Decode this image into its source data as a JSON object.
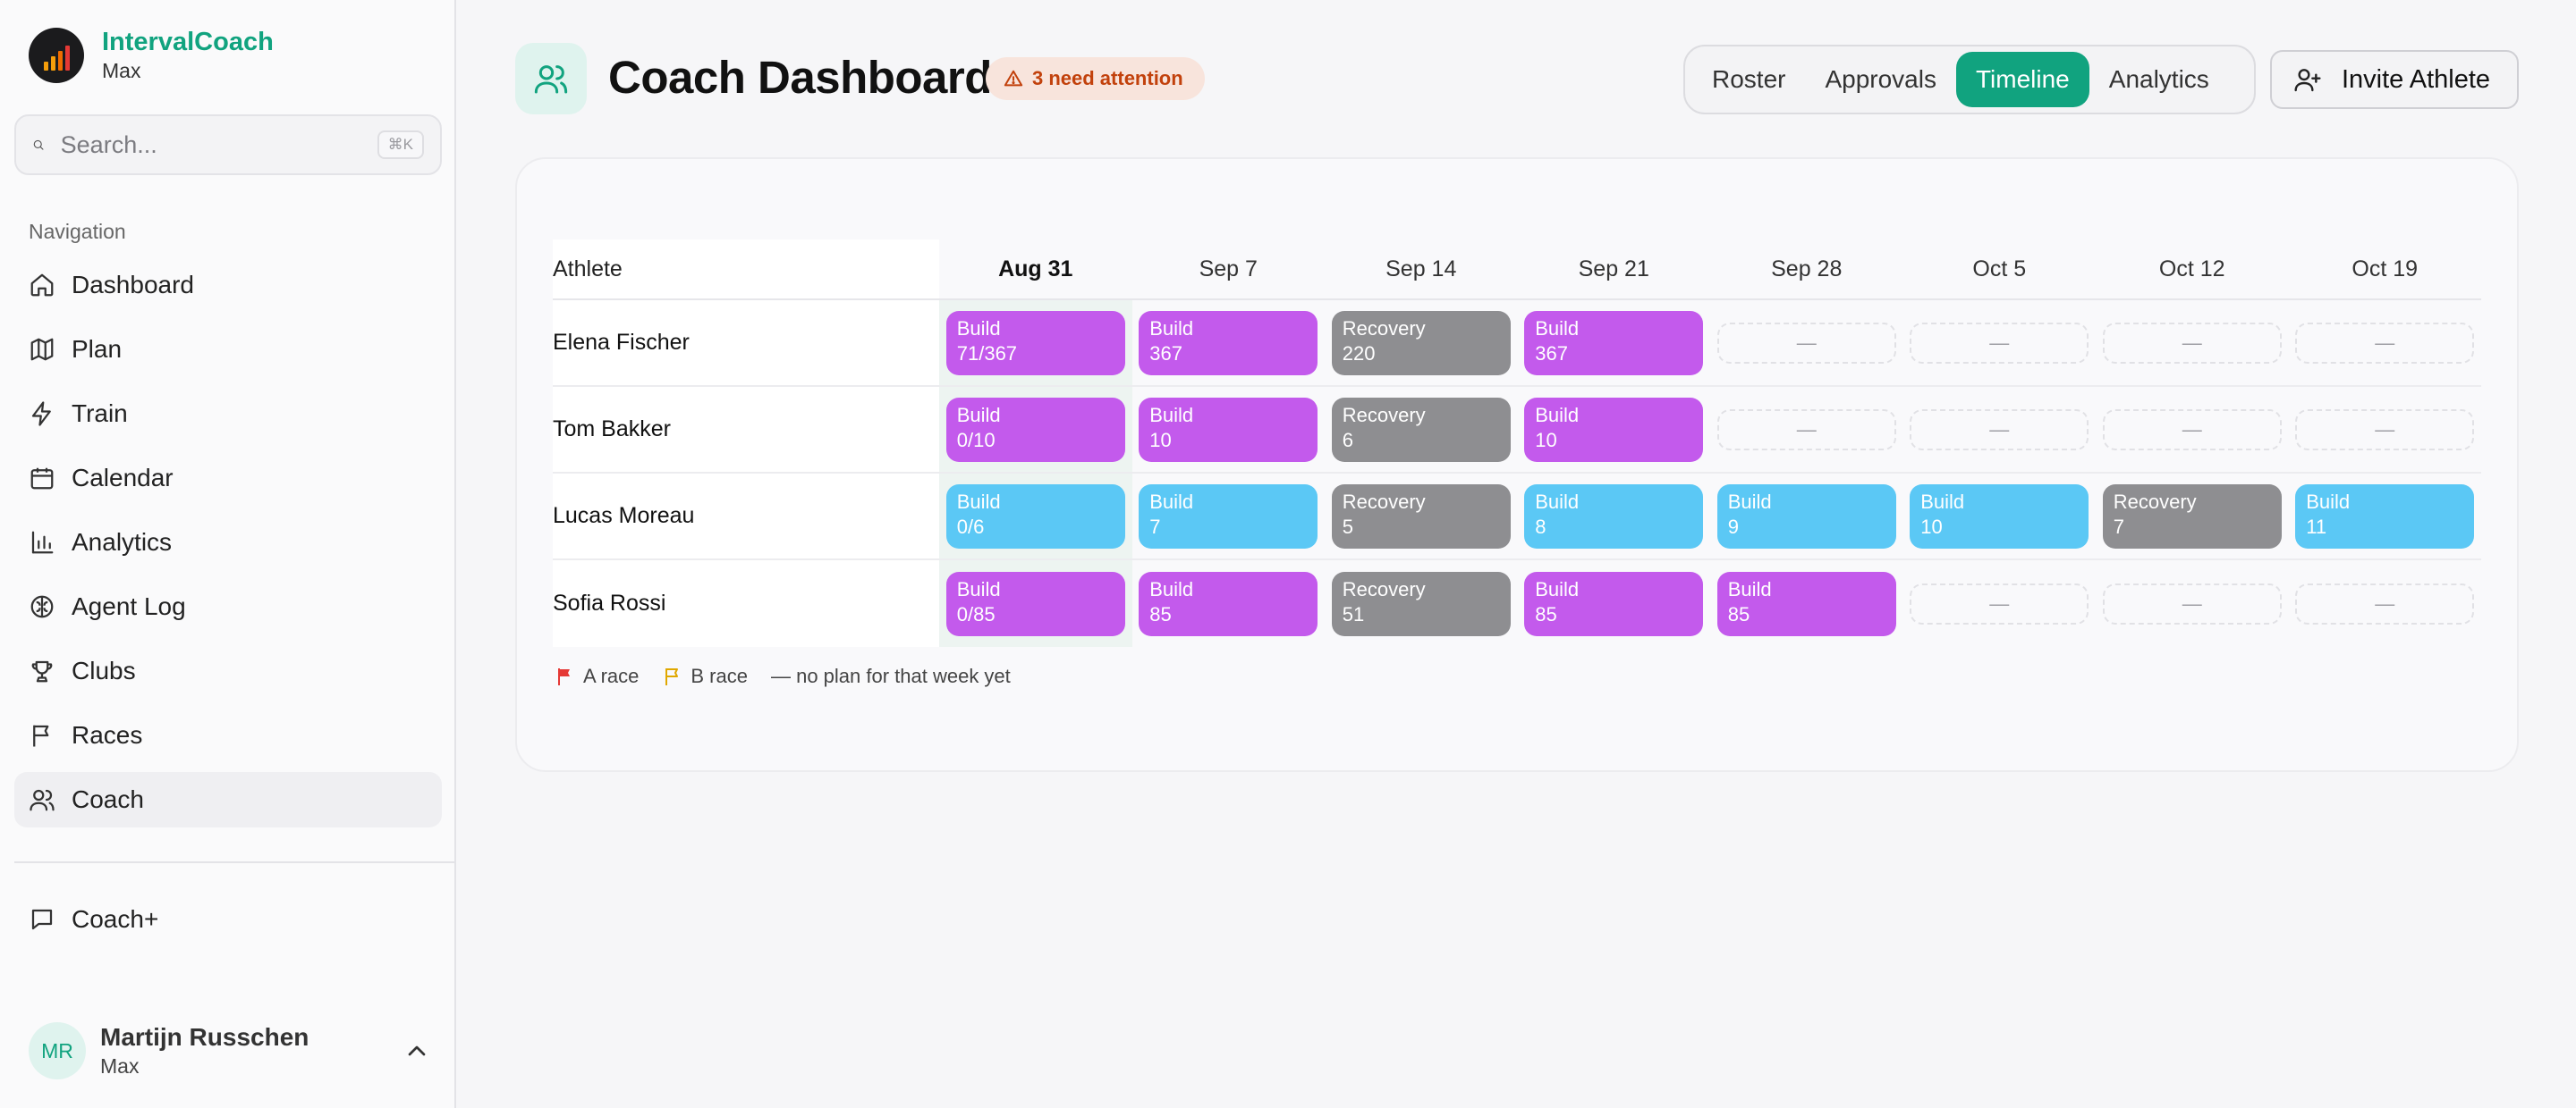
{
  "brand": {
    "name": "IntervalCoach",
    "subtitle": "Max"
  },
  "search": {
    "placeholder": "Search...",
    "shortcut": "⌘K"
  },
  "sidebar": {
    "section_label": "Navigation",
    "items": [
      {
        "label": "Dashboard",
        "icon": "home-icon"
      },
      {
        "label": "Plan",
        "icon": "map-icon"
      },
      {
        "label": "Train",
        "icon": "lightning-icon"
      },
      {
        "label": "Calendar",
        "icon": "calendar-icon"
      },
      {
        "label": "Analytics",
        "icon": "bar-chart-icon"
      },
      {
        "label": "Agent Log",
        "icon": "brain-icon"
      },
      {
        "label": "Clubs",
        "icon": "trophy-icon"
      },
      {
        "label": "Races",
        "icon": "flag-icon"
      },
      {
        "label": "Coach",
        "icon": "users-icon",
        "active": true
      }
    ],
    "footer_item": {
      "label": "Coach+",
      "icon": "message-icon"
    }
  },
  "user": {
    "initials": "MR",
    "name": "Martijn Russchen",
    "plan": "Max"
  },
  "header": {
    "title": "Coach Dashboard",
    "attention_badge": "3 need attention",
    "tabs": [
      "Roster",
      "Approvals",
      "Timeline",
      "Analytics"
    ],
    "active_tab": "Timeline",
    "invite_label": "Invite Athlete"
  },
  "timeline": {
    "athlete_header": "Athlete",
    "weeks": [
      "Aug 31",
      "Sep 7",
      "Sep 14",
      "Sep 21",
      "Sep 28",
      "Oct 5",
      "Oct 12",
      "Oct 19"
    ],
    "current_week": "Aug 31",
    "empty_marker": "—",
    "athletes": [
      {
        "name": "Elena Fischer",
        "color": "#c35aec",
        "weeks": [
          {
            "phase": "Build",
            "value": "71/367"
          },
          {
            "phase": "Build",
            "value": "367"
          },
          {
            "phase": "Recovery",
            "value": "220"
          },
          {
            "phase": "Build",
            "value": "367"
          },
          null,
          null,
          null,
          null
        ]
      },
      {
        "name": "Tom Bakker",
        "color": "#c35aec",
        "weeks": [
          {
            "phase": "Build",
            "value": "0/10"
          },
          {
            "phase": "Build",
            "value": "10"
          },
          {
            "phase": "Recovery",
            "value": "6"
          },
          {
            "phase": "Build",
            "value": "10"
          },
          null,
          null,
          null,
          null
        ]
      },
      {
        "name": "Lucas Moreau",
        "color": "#5bc8f5",
        "weeks": [
          {
            "phase": "Build",
            "value": "0/6"
          },
          {
            "phase": "Build",
            "value": "7"
          },
          {
            "phase": "Recovery",
            "value": "5"
          },
          {
            "phase": "Build",
            "value": "8"
          },
          {
            "phase": "Build",
            "value": "9"
          },
          {
            "phase": "Build",
            "value": "10"
          },
          {
            "phase": "Recovery",
            "value": "7"
          },
          {
            "phase": "Build",
            "value": "11"
          }
        ]
      },
      {
        "name": "Sofia Rossi",
        "color": "#c35aec",
        "weeks": [
          {
            "phase": "Build",
            "value": "0/85"
          },
          {
            "phase": "Build",
            "value": "85"
          },
          {
            "phase": "Recovery",
            "value": "51"
          },
          {
            "phase": "Build",
            "value": "85"
          },
          {
            "phase": "Build",
            "value": "85"
          },
          null,
          null,
          null
        ]
      }
    ],
    "legend": {
      "a_race": "A race",
      "b_race": "B race",
      "no_plan": "— no plan for that week yet"
    }
  },
  "colors": {
    "accent": "#11a37f",
    "build_purple": "#c35aec",
    "build_blue": "#5bc8f5",
    "recovery": "#8e8e91",
    "a_race": "#e53935",
    "b_race": "#e0a800"
  }
}
